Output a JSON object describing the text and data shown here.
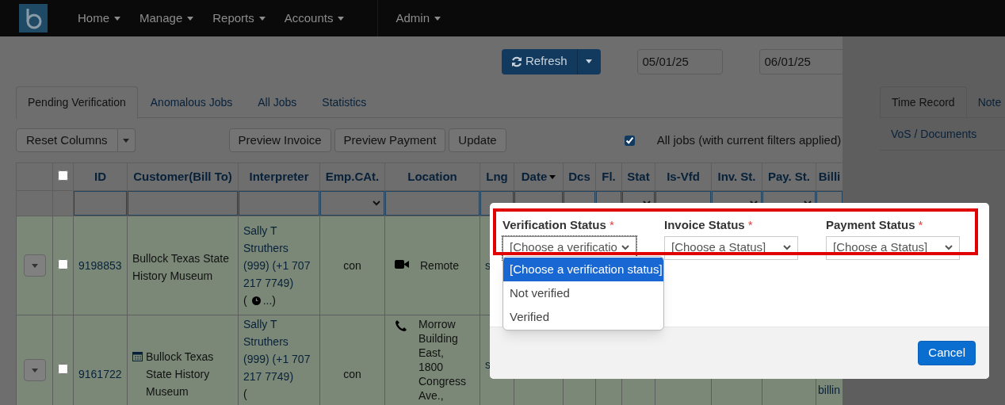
{
  "nav": {
    "items": [
      {
        "label": "Home"
      },
      {
        "label": "Manage"
      },
      {
        "label": "Reports"
      },
      {
        "label": "Accounts"
      },
      {
        "label": "Admin"
      }
    ]
  },
  "toolbar": {
    "refresh": "Refresh",
    "date_from": "05/01/25",
    "date_to": "06/01/25"
  },
  "tabs": [
    {
      "label": "Pending Verification",
      "selected": true
    },
    {
      "label": "Anomalous Jobs",
      "selected": false
    },
    {
      "label": "All Jobs",
      "selected": false
    },
    {
      "label": "Statistics",
      "selected": false
    }
  ],
  "side_tabs": [
    {
      "label": "Time Record",
      "selected": true
    },
    {
      "label": "Note",
      "selected": false
    },
    {
      "label": "VoS / Documents",
      "selected": false
    }
  ],
  "actions": {
    "reset": "Reset Columns",
    "buttons": [
      "Preview Invoice",
      "Preview Payment",
      "Update"
    ]
  },
  "all_jobs": {
    "checked": true,
    "label": "All jobs (with current filters applied)"
  },
  "table": {
    "select_all": {
      "checked": false
    },
    "columns": [
      {
        "label": "ID",
        "sorted": false
      },
      {
        "label": "Customer(Bill To)",
        "sorted": false
      },
      {
        "label": "Interpreter",
        "sorted": false
      },
      {
        "label": "Emp.CAt.",
        "sorted": false
      },
      {
        "label": "Location",
        "sorted": false
      },
      {
        "label": "Lng",
        "sorted": false
      },
      {
        "label": "Date",
        "sorted": true
      },
      {
        "label": "Dcs",
        "sorted": false
      },
      {
        "label": "Fl.",
        "sorted": false
      },
      {
        "label": "Stat",
        "sorted": false
      },
      {
        "label": "Is-Vfd",
        "sorted": false
      },
      {
        "label": "Inv. St.",
        "sorted": false
      },
      {
        "label": "Pay. St.",
        "sorted": false
      },
      {
        "label": "Billi",
        "sorted": false
      }
    ],
    "rows": [
      {
        "selected": false,
        "id": "9198853",
        "calendar": false,
        "customer": "Bullock Texas State History Museum",
        "interpreter": "Sally T Struthers (999) (+1 707 217 7749)",
        "open_paren": "(",
        "more": "...",
        "close_paren": ")",
        "emp": "con",
        "location": {
          "kind": "video",
          "text": "Remote"
        },
        "lng": "s"
      },
      {
        "selected": false,
        "id": "9161722",
        "calendar": true,
        "customer": "Bullock Texas State History Museum",
        "interpreter": "Sally T Struthers (999) (+1 707 217 7749)",
        "open_paren": "(",
        "emp": "con",
        "location": {
          "kind": "phone",
          "text": "Morrow Building East, 1800 Congress Ave.,"
        },
        "lng": "s",
        "billing": "billin"
      }
    ]
  },
  "modal": {
    "fields": [
      {
        "label": "Verification Status",
        "required": true,
        "required_mark": "*",
        "value": "[Choose a verificatio",
        "open": true
      },
      {
        "label": "Invoice Status",
        "required": true,
        "required_mark": "*",
        "value": "[Choose a Status]",
        "open": false
      },
      {
        "label": "Payment Status",
        "required": true,
        "required_mark": "*",
        "value": "[Choose a Status]",
        "open": false
      }
    ],
    "options": [
      {
        "label": "[Choose a verification status]",
        "selected": true
      },
      {
        "label": "Not verified",
        "selected": false
      },
      {
        "label": "Verified",
        "selected": false
      }
    ],
    "cancel": "Cancel"
  }
}
